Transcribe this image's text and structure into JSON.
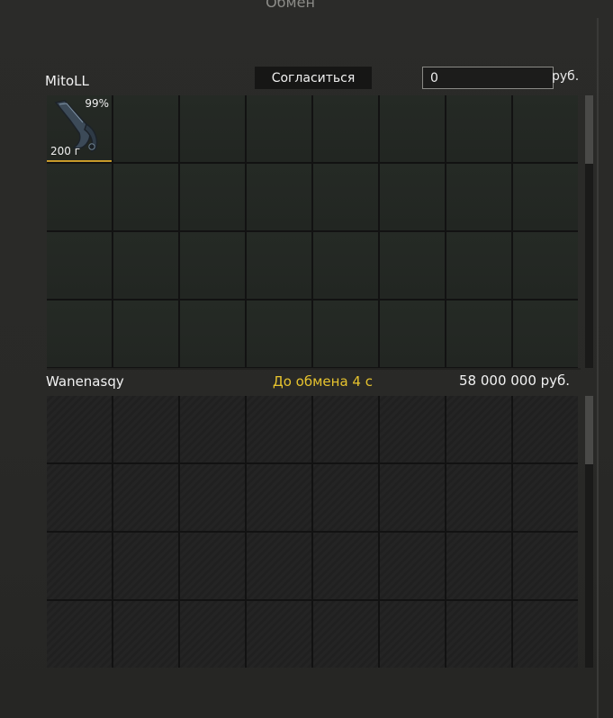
{
  "window": {
    "title": "Обмен"
  },
  "my_side": {
    "player_name": "MitoLL",
    "agree_label": "Согласиться",
    "money_value": "0",
    "currency": "руб.",
    "items": [
      {
        "condition": "99%",
        "weight": "200 г",
        "icon": "karambit-knife-icon",
        "rarity_color": "#c89a2a"
      }
    ]
  },
  "their_side": {
    "player_name": "Wanenasqy",
    "timer_text": "До обмена 4 с",
    "money_text": "58 000 000 руб.",
    "timer_color": "#e6c32e"
  }
}
